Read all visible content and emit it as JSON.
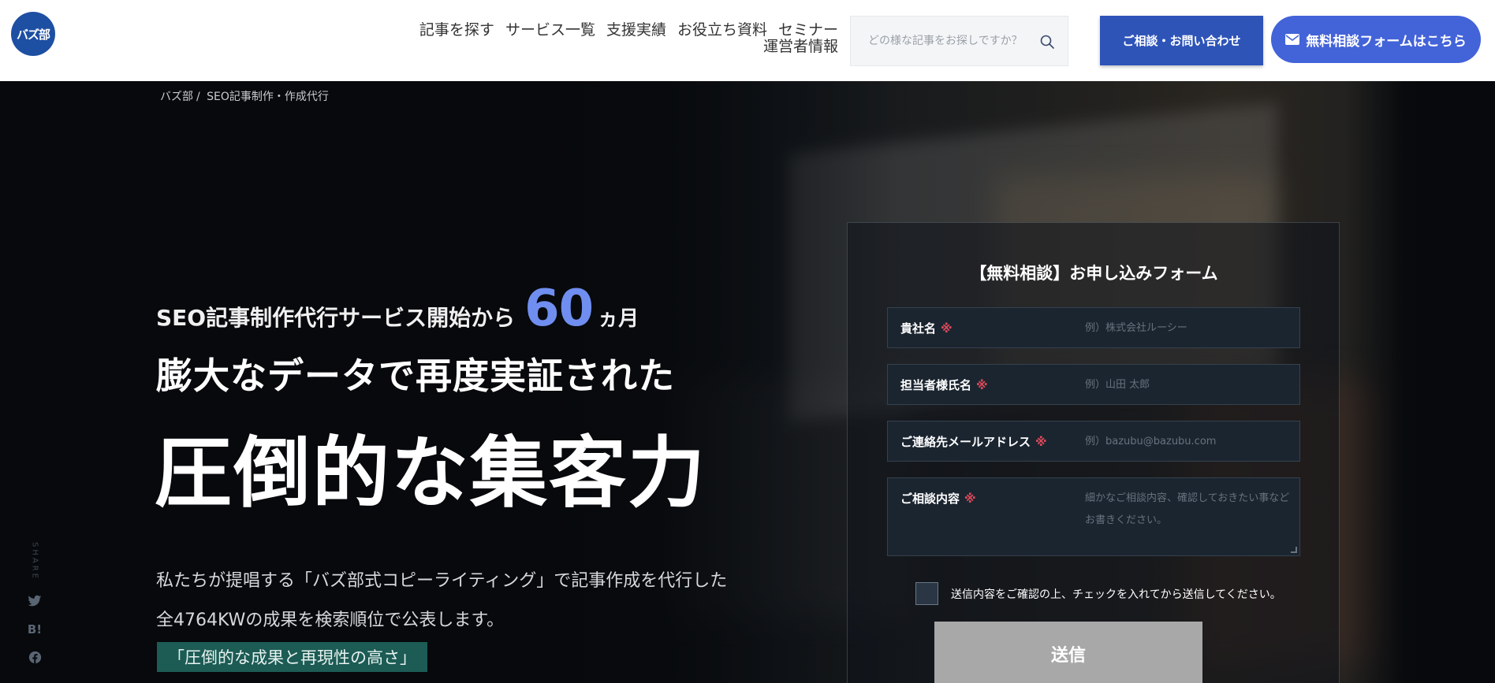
{
  "header": {
    "logo_text": "バズ部",
    "nav_row1": [
      "記事を探す",
      "サービス一覧",
      "支援実績",
      "お役立ち資料",
      "セミナー"
    ],
    "nav_row2": [
      "運営者情報"
    ],
    "search_placeholder": "どの様な記事をお探しですか？",
    "contact_button": "ご相談・お問い合わせ",
    "form_button": "無料相談フォームはこちら"
  },
  "breadcrumb": [
    "バズ部",
    "/",
    "SEO記事制作・作成代行"
  ],
  "hero": {
    "tagline_prefix": "SEO記事制作代行サービス開始から",
    "tagline_number": "60",
    "tagline_unit": "ヵ月",
    "sub_heading": "膨大なデータで再度実証された",
    "main_heading": "圧倒的な集客力",
    "description": "私たちが提唱する「バズ部式コピーライティング」で記事作成を代行した全4764KWの成果を検索順位で公表します。",
    "highlight": "「圧倒的な成果と再現性の高さ」"
  },
  "share": {
    "label": "SHARE",
    "hatena_text": "B!"
  },
  "form": {
    "title": "【無料相談】お申し込みフォーム",
    "fields": [
      {
        "label": "貴社名",
        "required": "※",
        "placeholder": "例）株式会社ルーシー"
      },
      {
        "label": "担当者様氏名",
        "required": "※",
        "placeholder": "例）山田 太郎"
      },
      {
        "label": "ご連絡先メールアドレス",
        "required": "※",
        "placeholder": "例）bazubu@bazubu.com"
      },
      {
        "label": "ご相談内容",
        "required": "※",
        "placeholder": "細かなご相談内容、確認しておきたい事などお書きください。"
      }
    ],
    "consent": "送信内容をご確認の上、チェックを入れてから送信してください。",
    "submit": "送信"
  },
  "colors": {
    "brand_blue": "#1d4fa3",
    "contact_button": "#2e54b8",
    "form_button": "#4363d8",
    "accent_number": "#6f8ef0",
    "highlight_bg": "#1d5b55",
    "required_mark": "#e0495a"
  },
  "icons": [
    "search-icon",
    "mail-icon",
    "twitter-icon",
    "hatena-icon",
    "facebook-icon"
  ]
}
